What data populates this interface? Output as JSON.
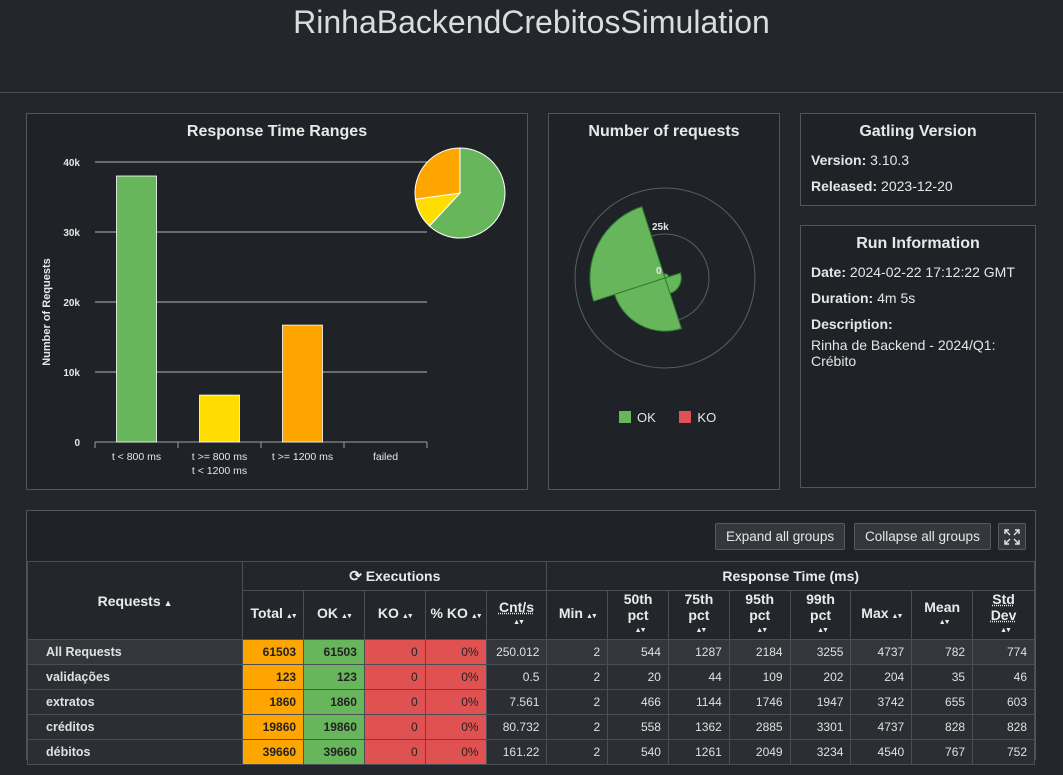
{
  "title": "RinhaBackendCrebitosSimulation",
  "rtr": {
    "title": "Response Time Ranges",
    "ylabel": "Number of Requests"
  },
  "chart_data": [
    {
      "type": "bar",
      "title": "Response Time Ranges",
      "ylabel": "Number of Requests",
      "categories": [
        "t < 800 ms",
        "t >= 800 ms t < 1200 ms",
        "t >= 1200 ms",
        "failed"
      ],
      "category_lines": [
        [
          "t < 800 ms"
        ],
        [
          "t >= 800 ms",
          "t < 1200 ms"
        ],
        [
          "t >= 1200 ms"
        ],
        [
          "failed"
        ]
      ],
      "values": [
        38000,
        6700,
        16700,
        0
      ],
      "colors": [
        "#68b65c",
        "#ffdd00",
        "#ffa500",
        "#e05252"
      ],
      "yticks": [
        "0",
        "10k",
        "20k",
        "30k",
        "40k"
      ],
      "ylim": [
        0,
        40000
      ],
      "grid": true
    },
    {
      "type": "pie",
      "slices": [
        {
          "label": "t < 800 ms",
          "value": 38000,
          "color": "#68b65c"
        },
        {
          "label": "t >= 800 ms t < 1200 ms",
          "value": 6700,
          "color": "#ffdd00"
        },
        {
          "label": "t >= 1200 ms",
          "value": 16700,
          "color": "#ffa500"
        }
      ]
    },
    {
      "type": "polar-area",
      "title": "Number of requests",
      "ring_labels": [
        "0",
        "25k"
      ],
      "series": [
        {
          "name": "OK",
          "values": [
            39660,
            123,
            1860,
            19860
          ]
        },
        {
          "name": "KO",
          "values": [
            0,
            0,
            0,
            0
          ]
        }
      ],
      "legend": [
        "OK",
        "KO"
      ],
      "colors": {
        "OK": "#68b65c",
        "KO": "#e05252"
      }
    }
  ],
  "nreq": {
    "title": "Number of requests",
    "ring_outer": "25k",
    "ring_inner": "0",
    "legend_ok": "OK",
    "legend_ko": "KO"
  },
  "gatling": {
    "title": "Gatling Version",
    "version_label": "Version:",
    "version": "3.10.3",
    "released_label": "Released:",
    "released": "2023-12-20"
  },
  "run": {
    "title": "Run Information",
    "date_label": "Date:",
    "date": "2024-02-22 17:12:22 GMT",
    "duration_label": "Duration:",
    "duration": "4m 5s",
    "description_label": "Description:",
    "description": "Rinha de Backend - 2024/Q1: Crébito"
  },
  "buttons": {
    "expand": "Expand all groups",
    "collapse": "Collapse all groups"
  },
  "table": {
    "requests_header": "Requests",
    "executions_header": "Executions",
    "response_header": "Response Time (ms)",
    "columns": [
      "Total",
      "OK",
      "KO",
      "% KO",
      "Cnt/s",
      "Min",
      "50th pct",
      "75th pct",
      "95th pct",
      "99th pct",
      "Max",
      "Mean",
      "Std Dev"
    ],
    "rows": [
      {
        "name": "All Requests",
        "total": "61503",
        "ok": "61503",
        "ko": "0",
        "pko": "0%",
        "cnt": "250.012",
        "min": "2",
        "p50": "544",
        "p75": "1287",
        "p95": "2184",
        "p99": "3255",
        "max": "4737",
        "mean": "782",
        "std": "774"
      },
      {
        "name": "validações",
        "total": "123",
        "ok": "123",
        "ko": "0",
        "pko": "0%",
        "cnt": "0.5",
        "min": "2",
        "p50": "20",
        "p75": "44",
        "p95": "109",
        "p99": "202",
        "max": "204",
        "mean": "35",
        "std": "46"
      },
      {
        "name": "extratos",
        "total": "1860",
        "ok": "1860",
        "ko": "0",
        "pko": "0%",
        "cnt": "7.561",
        "min": "2",
        "p50": "466",
        "p75": "1144",
        "p95": "1746",
        "p99": "1947",
        "max": "3742",
        "mean": "655",
        "std": "603"
      },
      {
        "name": "créditos",
        "total": "19860",
        "ok": "19860",
        "ko": "0",
        "pko": "0%",
        "cnt": "80.732",
        "min": "2",
        "p50": "558",
        "p75": "1362",
        "p95": "2885",
        "p99": "3301",
        "max": "4737",
        "mean": "828",
        "std": "828"
      },
      {
        "name": "débitos",
        "total": "39660",
        "ok": "39660",
        "ko": "0",
        "pko": "0%",
        "cnt": "161.22",
        "min": "2",
        "p50": "540",
        "p75": "1261",
        "p95": "2049",
        "p99": "3234",
        "max": "4540",
        "mean": "767",
        "std": "752"
      }
    ]
  }
}
